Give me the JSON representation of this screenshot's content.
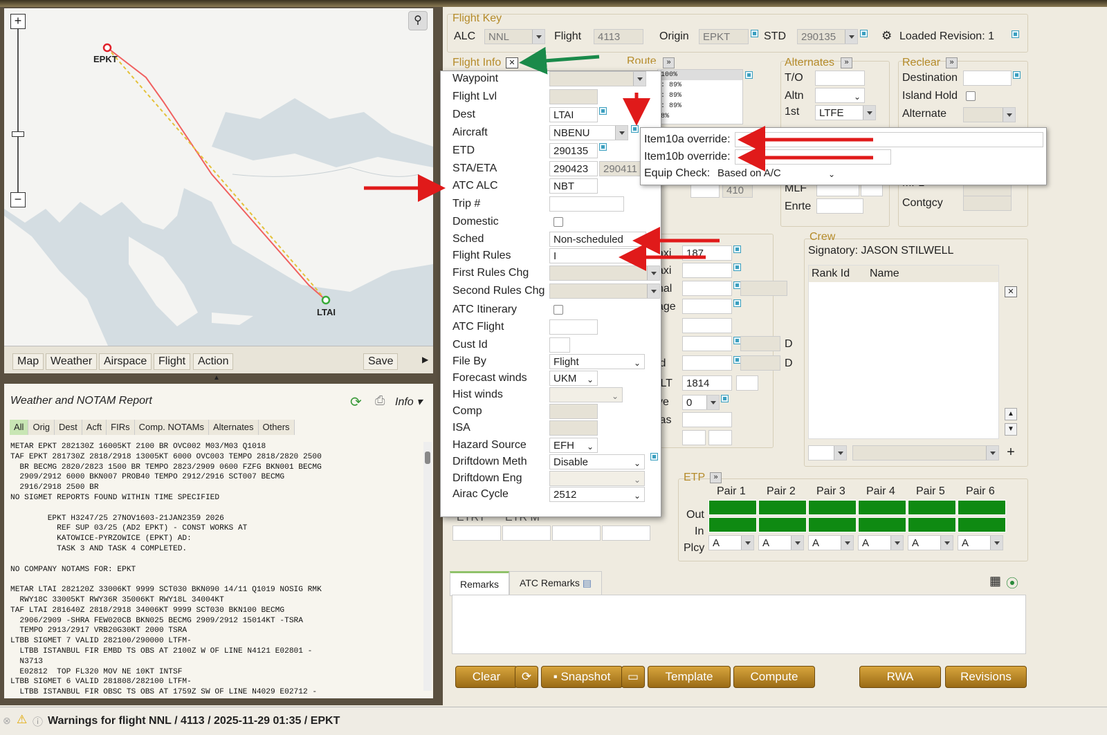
{
  "map": {
    "origin": "EPKT",
    "dest": "LTAI",
    "zoom_plus": "+",
    "zoom_minus": "−"
  },
  "map_toolbar": {
    "map": "Map",
    "weather": "Weather",
    "airspace": "Airspace",
    "flight": "Flight",
    "action": "Action",
    "save": "Save"
  },
  "wx": {
    "title": "Weather and NOTAM Report",
    "info": "Info",
    "tabs": [
      "All",
      "Orig",
      "Dest",
      "Acft",
      "FIRs",
      "Comp. NOTAMs",
      "Alternates",
      "Others"
    ],
    "body": "METAR EPKT 282130Z 16005KT 2100 BR OVC002 M03/M03 Q1018\nTAF EPKT 281730Z 2818/2918 13005KT 6000 OVC003 TEMPO 2818/2820 2500\n  BR BECMG 2820/2823 1500 BR TEMPO 2823/2909 0600 FZFG BKN001 BECMG\n  2909/2912 6000 BKN007 PROB40 TEMPO 2912/2916 SCT007 BECMG\n  2916/2918 2500 BR\nNO SIGMET REPORTS FOUND WITHIN TIME SPECIFIED\n\n        EPKT H3247/25 27NOV1603-21JAN2359 2026\n          REF SUP 03/25 (AD2 EPKT) - CONST WORKS AT\n          KATOWICE-PYRZOWICE (EPKT) AD:\n          TASK 3 AND TASK 4 COMPLETED.\n\nNO COMPANY NOTAMS FOR: EPKT\n\nMETAR LTAI 282120Z 33006KT 9999 SCT030 BKN090 14/11 Q1019 NOSIG RMK\n  RWY18C 33005KT RWY36R 35006KT RWY18L 34004KT\nTAF LTAI 281640Z 2818/2918 34006KT 9999 SCT030 BKN100 BECMG\n  2906/2909 -SHRA FEW020CB BKN025 BECMG 2909/2912 15014KT -TSRA\n  TEMPO 2913/2917 VRB20G30KT 2000 TSRA\nLTBB SIGMET 7 VALID 282100/290000 LTFM-\n  LTBB ISTANBUL FIR EMBD TS OBS AT 2100Z W OF LINE N4121 E02801 -\n  N3713\n  E02812  TOP FL320 MOV NE 10KT INTSF\nLTBB SIGMET 6 VALID 281808/282100 LTFM-\n  LTBB ISTANBUL FIR OBSC TS OBS AT 1759Z SW OF LINE N4029 E02712 -"
  },
  "status": {
    "text": "Warnings for flight NNL / 4113 / 2025-11-29 01:35 / EPKT"
  },
  "flight_key": {
    "title": "Flight Key",
    "alc_label": "ALC",
    "alc": "NNL",
    "flight_label": "Flight",
    "flight": "4113",
    "origin_label": "Origin",
    "origin": "EPKT",
    "std_label": "STD",
    "std": "290135",
    "loaded": "Loaded Revision: 1"
  },
  "flight_info": {
    "title": "Flight Info",
    "close": "✕",
    "waypoint": "Waypoint",
    "flight_lvl": "Flight Lvl",
    "dest": "Dest",
    "dest_val": "LTAI",
    "aircraft": "Aircraft",
    "aircraft_val": "NBENU",
    "etd": "ETD",
    "etd_val": "290135",
    "sta": "STA/ETA",
    "sta_val": "290423",
    "eta_val": "290411",
    "atc_alc": "ATC ALC",
    "atc_alc_val": "NBT",
    "trip": "Trip #",
    "domestic": "Domestic",
    "sched": "Sched",
    "sched_val": "Non-scheduled",
    "rules": "Flight Rules",
    "rules_val": "I",
    "first_rules": "First Rules Chg",
    "second_rules": "Second Rules Chg",
    "atc_itin": "ATC Itinerary",
    "atc_flight": "ATC Flight",
    "cust_id": "Cust Id",
    "file_by": "File By",
    "file_by_val": "Flight",
    "fc_winds": "Forecast winds",
    "fc_winds_val": "UKM",
    "hist_winds": "Hist winds",
    "comp": "Comp",
    "isa": "ISA",
    "hazard": "Hazard Source",
    "hazard_val": "EFH",
    "dd_meth": "Driftdown Meth",
    "dd_meth_val": "Disable",
    "dd_eng": "Driftdown Eng",
    "airac": "Airac Cycle",
    "airac_val": "2512"
  },
  "override": {
    "item10a": "Item10a override:",
    "item10b": "Item10b override:",
    "equip": "Equip Check:",
    "equip_val": "Based on A/C"
  },
  "route": {
    "title": "Route",
    "lines": [
      "100%",
      ": 89%",
      ": 89%",
      ": 89%",
      "8%"
    ]
  },
  "alternates": {
    "title": "Alternates",
    "to": "T/O",
    "altn": "Altn",
    "first": "1st",
    "first_val": "LTFE",
    "mlf": "MLF",
    "enrte": "Enrte"
  },
  "reclear": {
    "title": "Reclear",
    "destination": "Destination",
    "island": "Island Hold",
    "alternate": "Alternate",
    "mfl": "MFL",
    "contgcy": "Contgcy"
  },
  "fuel": {
    "taxi": "axi",
    "taxi_val": "187",
    "taxi2": "axi",
    "final": "nal",
    "storage": "age",
    "d1": "D",
    "d2": "D",
    "ld": "ld",
    "ilt": "ILT",
    "ilt_val": "1814",
    "ve": "ve",
    "ve_val": "0",
    "ias": "ias",
    "val410": "410"
  },
  "crew": {
    "title": "Crew",
    "signatory": "Signatory: JASON STILWELL",
    "rank": "Rank Id",
    "name": "Name"
  },
  "etp": {
    "title": "ETP",
    "pairs": [
      "Pair 1",
      "Pair 2",
      "Pair 3",
      "Pair 4",
      "Pair 5",
      "Pair 6"
    ],
    "out": "Out",
    "in": "In",
    "plcy": "Plcy",
    "plcy_val": "A"
  },
  "remarks": {
    "tab1": "Remarks",
    "tab2": "ATC Remarks"
  },
  "lower": {
    "etrt": "ETRT",
    "etrm": "ETR M"
  },
  "buttons": {
    "clear": "Clear",
    "snapshot": "Snapshot",
    "template": "Template",
    "compute": "Compute",
    "rwa": "RWA",
    "revisions": "Revisions"
  }
}
